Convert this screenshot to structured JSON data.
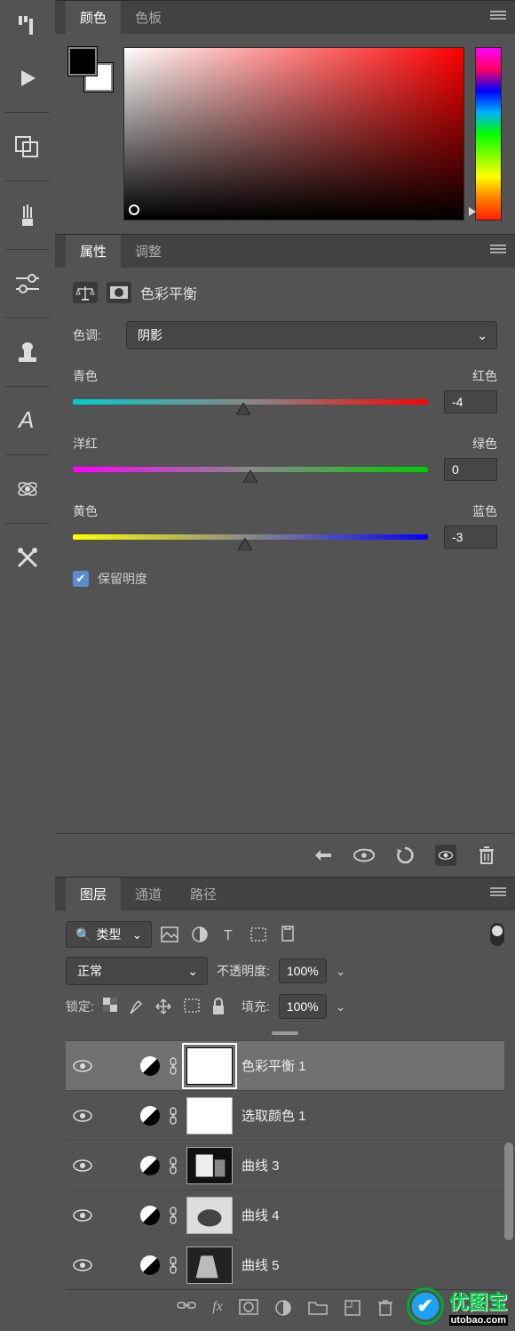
{
  "color_panel": {
    "tabs": {
      "color": "颜色",
      "swatches": "色板"
    },
    "fg_color": "#000000",
    "bg_color": "#ffffff"
  },
  "properties_panel": {
    "tabs": {
      "properties": "属性",
      "adjustments": "调整"
    },
    "adjustment_title": "色彩平衡",
    "tone_label": "色调:",
    "tone_value": "阴影",
    "sliders": [
      {
        "left": "青色",
        "right": "红色",
        "value": "-4"
      },
      {
        "left": "洋红",
        "right": "绿色",
        "value": "0"
      },
      {
        "left": "黄色",
        "right": "蓝色",
        "value": "-3"
      }
    ],
    "preserve_luminosity": "保留明度",
    "preserve_checked": true
  },
  "layers_panel": {
    "tabs": {
      "layers": "图层",
      "channels": "通道",
      "paths": "路径"
    },
    "filter_kind": "类型",
    "blend_mode": "正常",
    "opacity_label": "不透明度:",
    "opacity_value": "100%",
    "lock_label": "锁定:",
    "fill_label": "填充:",
    "fill_value": "100%",
    "layers": [
      {
        "name": "色彩平衡 1",
        "type": "adj",
        "selected": true,
        "mask_selected": true
      },
      {
        "name": "选取颜色 1",
        "type": "adj",
        "selected": false
      },
      {
        "name": "曲线 3",
        "type": "adj-img",
        "selected": false
      },
      {
        "name": "曲线 4",
        "type": "adj-img",
        "selected": false
      },
      {
        "name": "曲线 5",
        "type": "adj-img",
        "selected": false
      }
    ]
  },
  "watermark": {
    "text": "优图宝",
    "sub": "utobao.com"
  }
}
